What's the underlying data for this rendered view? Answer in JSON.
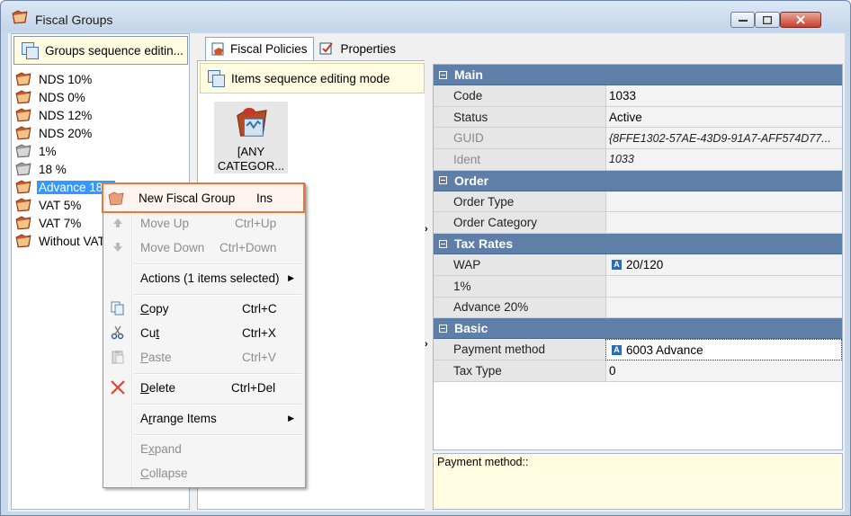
{
  "window": {
    "title": "Fiscal Groups"
  },
  "left": {
    "seq_button": "Groups sequence editin...",
    "items": [
      {
        "label": "NDS 10%",
        "selected": false
      },
      {
        "label": "NDS 0%",
        "selected": false
      },
      {
        "label": "NDS 12%",
        "selected": false
      },
      {
        "label": "NDS 20%",
        "selected": false
      },
      {
        "label": "1%",
        "selected": false
      },
      {
        "label": "18 %",
        "selected": false
      },
      {
        "label": "Advance 18%",
        "selected": true
      },
      {
        "label": "VAT 5%",
        "selected": false
      },
      {
        "label": "VAT 7%",
        "selected": false
      },
      {
        "label": "Without VAT",
        "selected": false
      }
    ]
  },
  "tabs": [
    {
      "label": "Fiscal Policies",
      "icon": "fiscal-policies-icon"
    },
    {
      "label": "Properties",
      "icon": "properties-icon"
    }
  ],
  "middle": {
    "seq_button": "Items sequence editing mode",
    "any_category": "[ANY CATEGOR..."
  },
  "props": {
    "main": {
      "title": "Main",
      "code_label": "Code",
      "code_value": "1033",
      "status_label": "Status",
      "status_value": "Active",
      "guid_label": "GUID",
      "guid_value": "{8FFE1302-57AE-43D9-91A7-AFF574D77...",
      "ident_label": "Ident",
      "ident_value": "1033"
    },
    "order": {
      "title": "Order",
      "type_label": "Order Type",
      "category_label": "Order Category"
    },
    "tax": {
      "title": "Tax Rates",
      "wap_label": "WAP",
      "wap_value": "20/120",
      "one_label": "1%",
      "adv_label": "Advance 20%"
    },
    "basic": {
      "title": "Basic",
      "payment_label": "Payment method",
      "payment_value": "6003 Advance",
      "taxtype_label": "Tax Type",
      "taxtype_value": "0"
    },
    "badge": "A",
    "description": "Payment method::"
  },
  "menu": {
    "new_group": "New Fiscal Group",
    "new_group_sc": "Ins",
    "move_up": "Move Up",
    "move_up_sc": "Ctrl+Up",
    "move_down": "Move Down",
    "move_down_sc": "Ctrl+Down",
    "actions": "Actions (1 items selected)",
    "copy_pre": "C",
    "copy_rest": "opy",
    "copy_sc": "Ctrl+C",
    "cut_pre": "Cu",
    "cut_u": "t",
    "cut_sc": "Ctrl+X",
    "paste_pre": "P",
    "paste_rest": "aste",
    "paste_sc": "Ctrl+V",
    "delete_pre": "D",
    "delete_rest": "elete",
    "delete_sc": "Ctrl+Del",
    "arrange_pre": "A",
    "arrange_u": "r",
    "arrange_rest": "range Items",
    "expand_pre": "E",
    "expand_u": "x",
    "expand_rest": "pand",
    "collapse_pre": "C",
    "collapse_rest": "ollapse"
  },
  "colors": {
    "accent": "#e8773a",
    "category": "#5f7fa8",
    "selection": "#3399ff"
  }
}
